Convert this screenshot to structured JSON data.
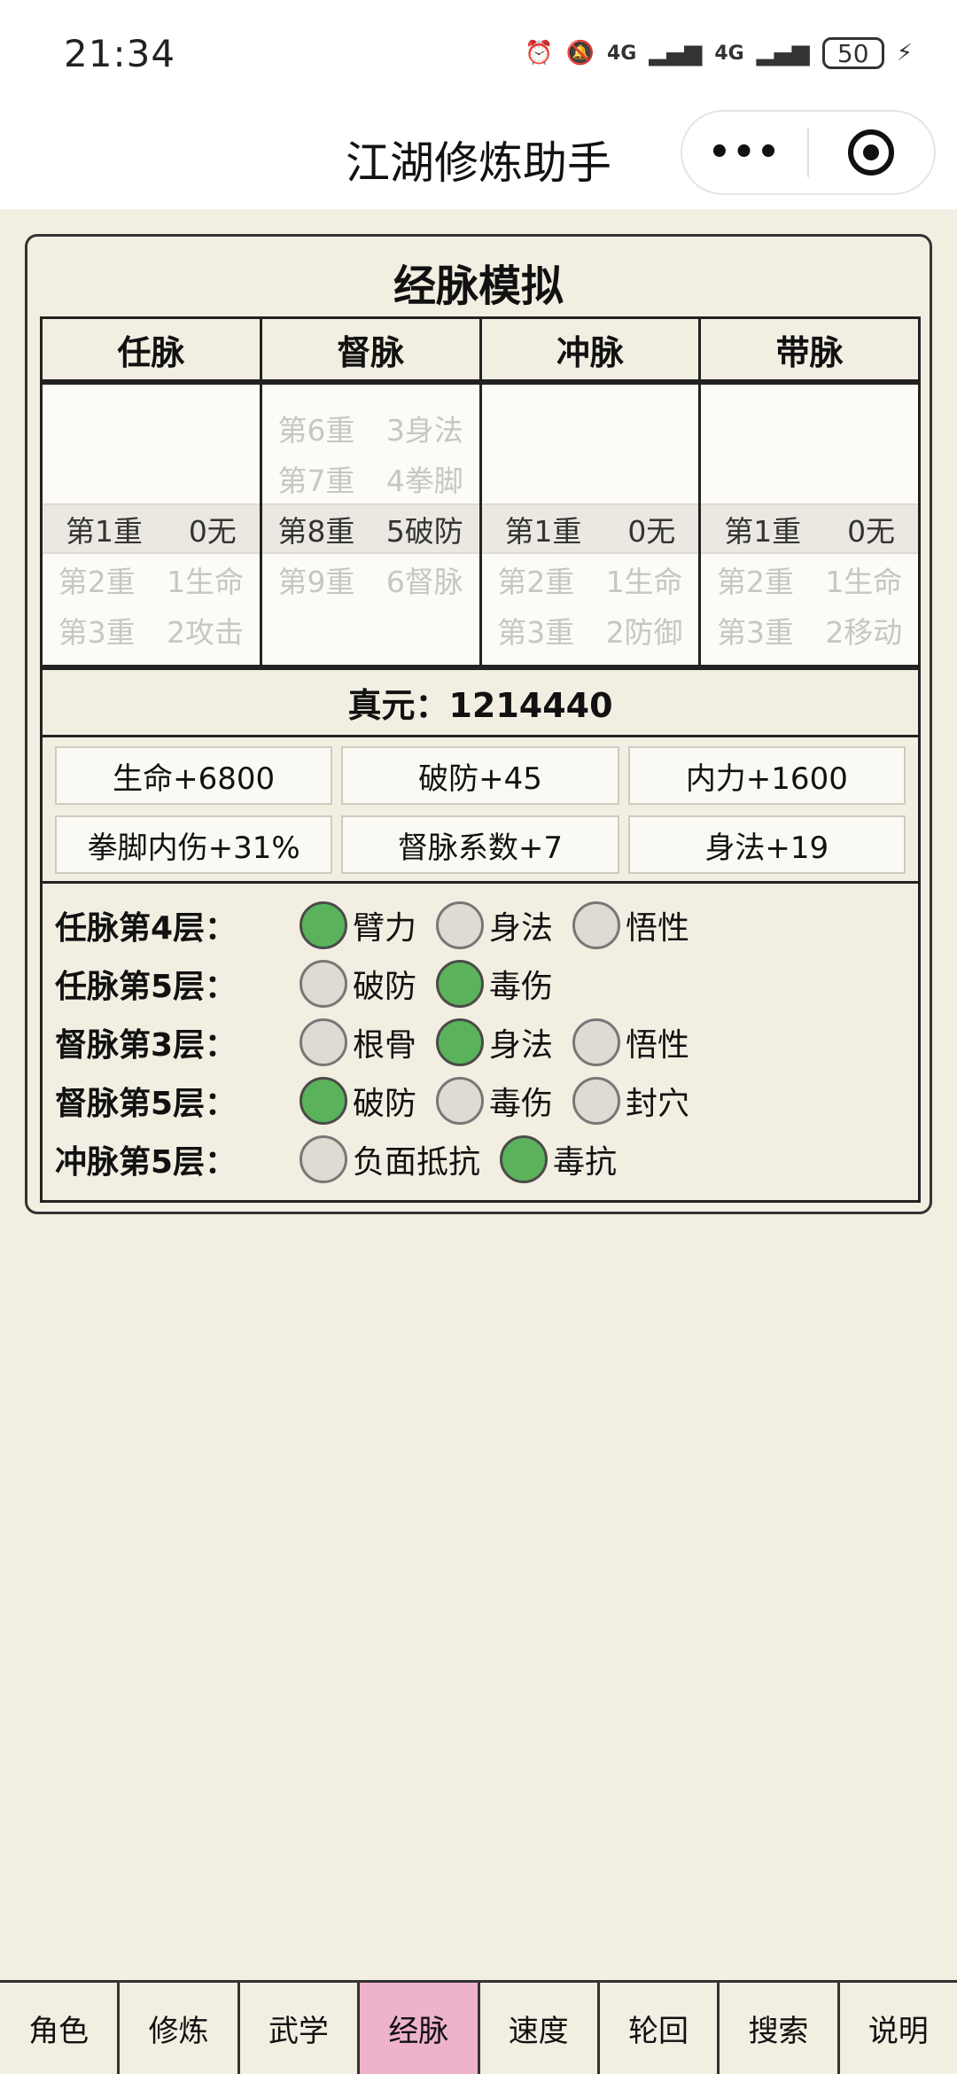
{
  "status_bar": {
    "time": "21:34",
    "signal1": "4G",
    "signal2": "4G",
    "battery": "50"
  },
  "header": {
    "title": "江湖修炼助手",
    "more_label": "•••"
  },
  "card": {
    "title": "经脉模拟",
    "columns": [
      "任脉",
      "督脉",
      "冲脉",
      "带脉"
    ],
    "pickers": [
      {
        "rows": [
          {
            "level": "第1重",
            "value": "0无",
            "selected": true
          },
          {
            "level": "第2重",
            "value": "1生命"
          },
          {
            "level": "第3重",
            "value": "2攻击"
          }
        ]
      },
      {
        "rows": [
          {
            "level": "第6重",
            "value": "3身法"
          },
          {
            "level": "第7重",
            "value": "4拳脚"
          },
          {
            "level": "第8重",
            "value": "5破防",
            "selected": true
          },
          {
            "level": "第9重",
            "value": "6督脉"
          }
        ]
      },
      {
        "rows": [
          {
            "level": "第1重",
            "value": "0无",
            "selected": true
          },
          {
            "level": "第2重",
            "value": "1生命"
          },
          {
            "level": "第3重",
            "value": "2防御"
          }
        ]
      },
      {
        "rows": [
          {
            "level": "第1重",
            "value": "0无",
            "selected": true
          },
          {
            "level": "第2重",
            "value": "1生命"
          },
          {
            "level": "第3重",
            "value": "2移动"
          }
        ]
      }
    ],
    "energy": "真元：1214440",
    "bonuses": [
      "生命+6800",
      "破防+45",
      "内力+1600",
      "拳脚内伤+31%",
      "督脉系数+7",
      "身法+19"
    ],
    "choices": [
      {
        "label": "任脉第4层：",
        "options": [
          {
            "text": "臂力",
            "on": true
          },
          {
            "text": "身法",
            "on": false
          },
          {
            "text": "悟性",
            "on": false
          }
        ]
      },
      {
        "label": "任脉第5层：",
        "options": [
          {
            "text": "破防",
            "on": false
          },
          {
            "text": "毒伤",
            "on": true
          }
        ]
      },
      {
        "label": "督脉第3层：",
        "options": [
          {
            "text": "根骨",
            "on": false
          },
          {
            "text": "身法",
            "on": true
          },
          {
            "text": "悟性",
            "on": false
          }
        ]
      },
      {
        "label": "督脉第5层：",
        "options": [
          {
            "text": "破防",
            "on": true
          },
          {
            "text": "毒伤",
            "on": false
          },
          {
            "text": "封穴",
            "on": false
          }
        ]
      },
      {
        "label": "冲脉第5层：",
        "options": [
          {
            "text": "负面抵抗",
            "on": false
          },
          {
            "text": "毒抗",
            "on": true
          }
        ]
      }
    ]
  },
  "tabs": [
    {
      "label": "角色"
    },
    {
      "label": "修炼"
    },
    {
      "label": "武学"
    },
    {
      "label": "经脉",
      "active": true
    },
    {
      "label": "速度"
    },
    {
      "label": "轮回"
    },
    {
      "label": "搜索"
    },
    {
      "label": "说明"
    }
  ],
  "colors": {
    "accent_tab": "#eeb2cc",
    "selected_dot": "#5ab35a",
    "background": "#f2efe2"
  }
}
